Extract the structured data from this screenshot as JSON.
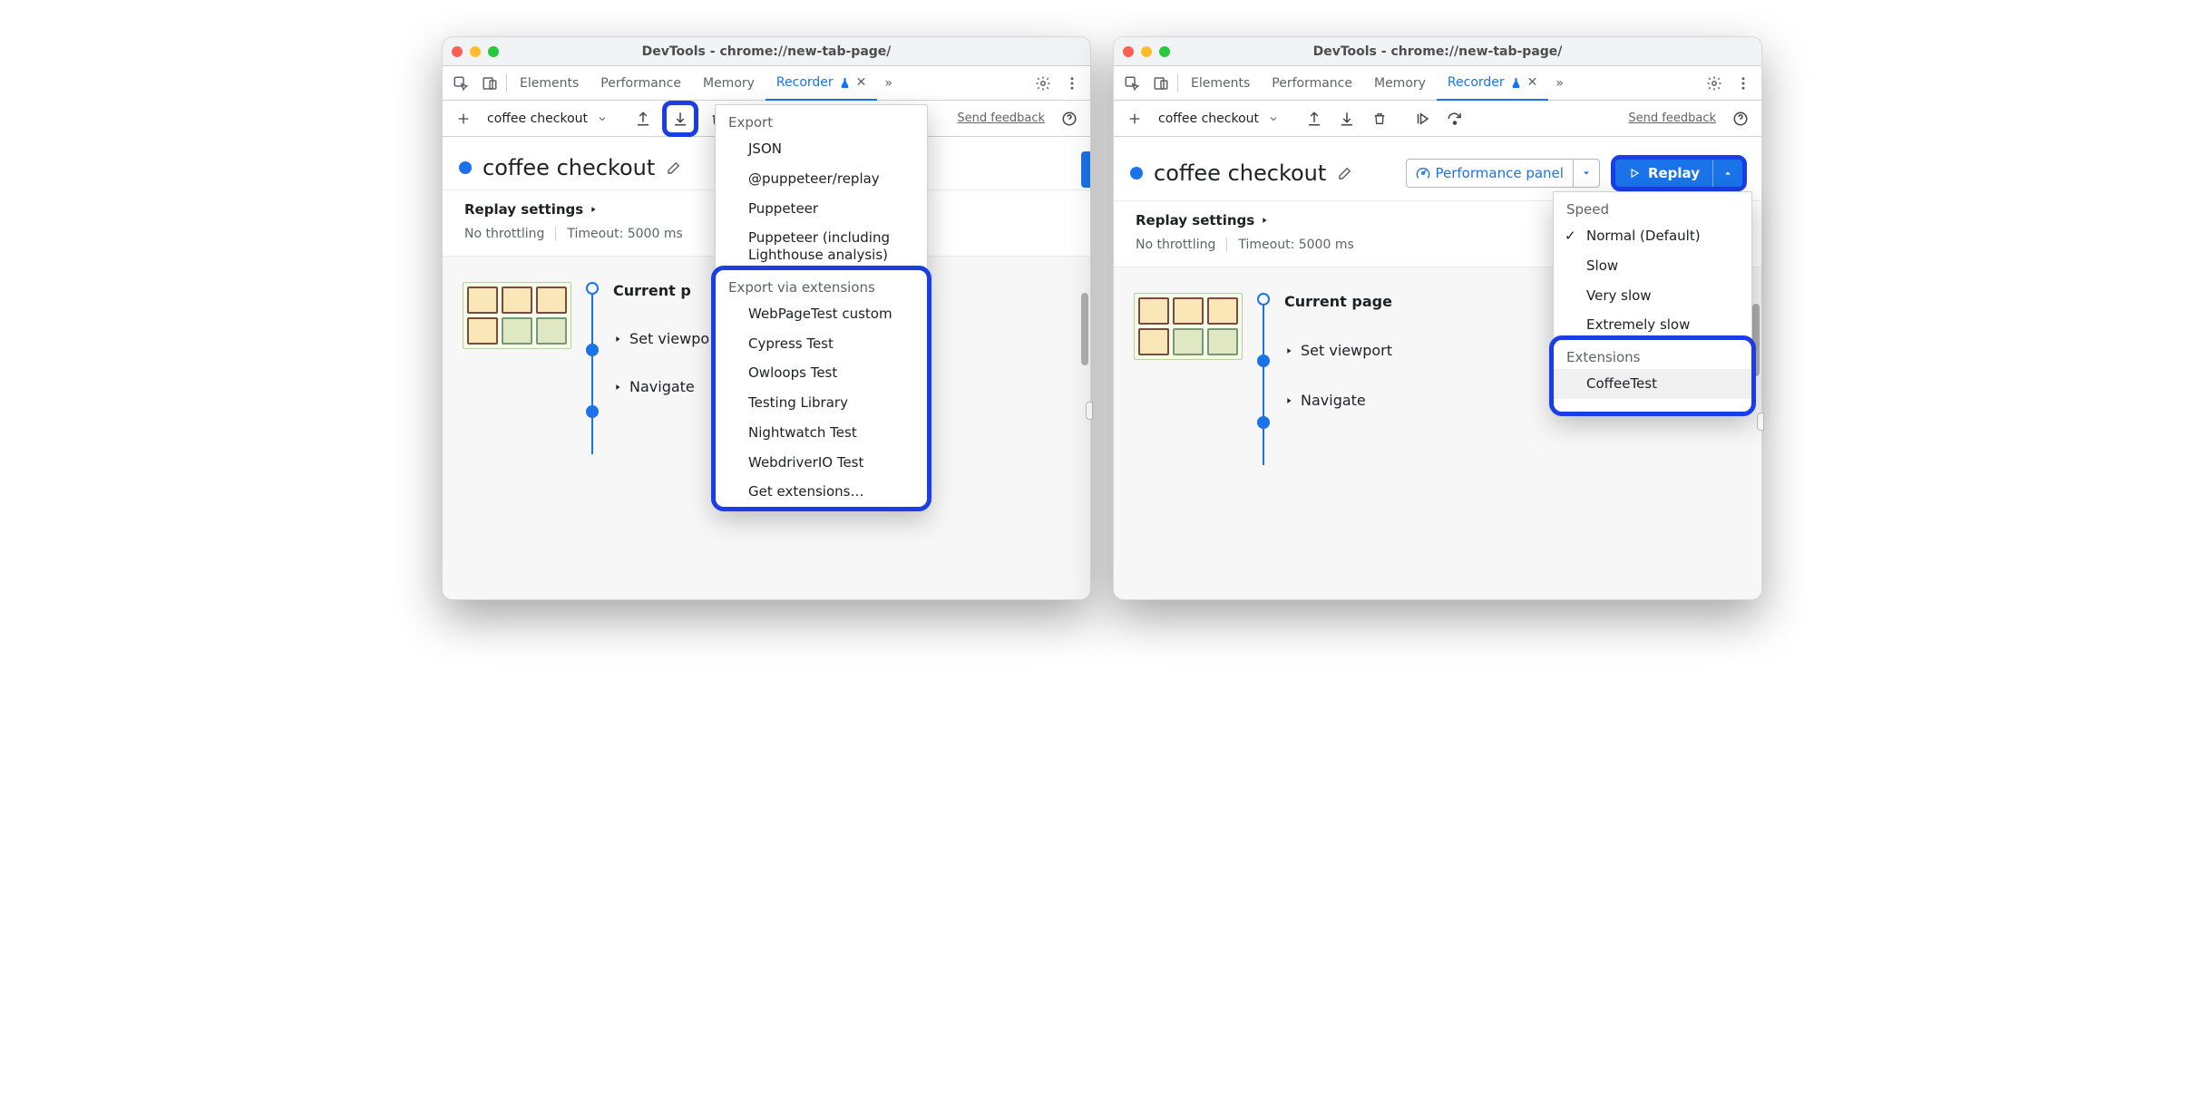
{
  "window_title": "DevTools - chrome://new-tab-page/",
  "tabs": {
    "elements": "Elements",
    "performance": "Performance",
    "memory": "Memory",
    "recorder": "Recorder",
    "more": "»"
  },
  "toolbar": {
    "recording_name": "coffee checkout",
    "send_feedback": "Send feedback"
  },
  "header": {
    "title": "coffee checkout",
    "replay_settings": "Replay settings",
    "throttle": "No throttling",
    "timeout": "Timeout: 5000 ms",
    "performance_panel": "Performance panel",
    "replay": "Replay"
  },
  "steps": {
    "current_page": "Current page",
    "current_p_trunc": "Current p",
    "set_viewport": "Set viewport",
    "set_viewport_trunc": "Set viewpo",
    "navigate": "Navigate"
  },
  "export_menu": {
    "section1": "Export",
    "items1": [
      "JSON",
      "@puppeteer/replay",
      "Puppeteer",
      "Puppeteer (including Lighthouse analysis)"
    ],
    "section2": "Export via extensions",
    "items2": [
      "WebPageTest custom",
      "Cypress Test",
      "Owloops Test",
      "Testing Library",
      "Nightwatch Test",
      "WebdriverIO Test",
      "Get extensions…"
    ]
  },
  "replay_menu": {
    "section1": "Speed",
    "items1": [
      "Normal (Default)",
      "Slow",
      "Very slow",
      "Extremely slow"
    ],
    "section2": "Extensions",
    "items2": [
      "CoffeeTest"
    ]
  }
}
